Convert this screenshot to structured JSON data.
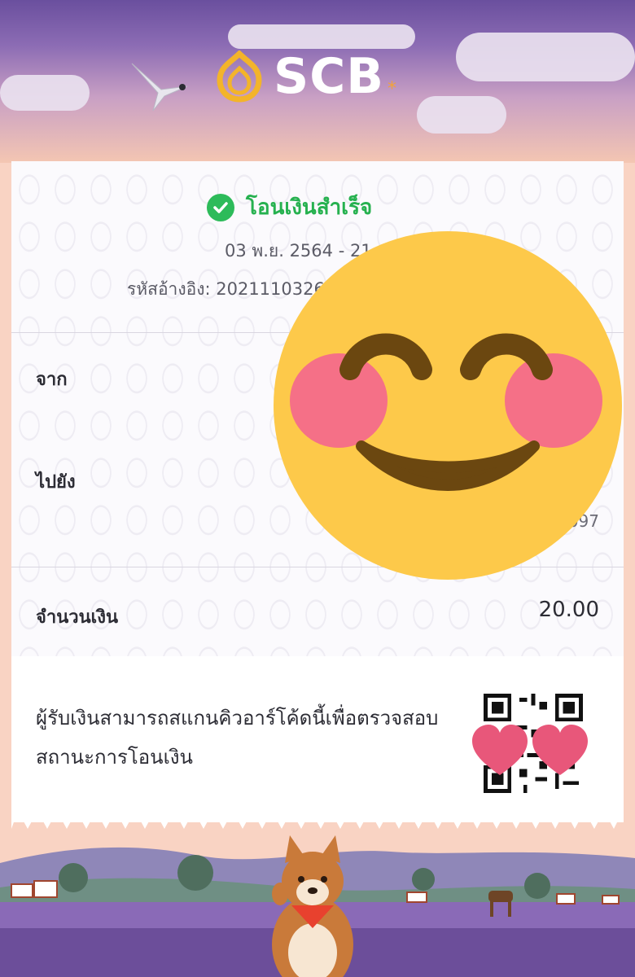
{
  "brand": {
    "name": "SCB",
    "star": "*"
  },
  "receipt": {
    "status": "โอนเงินสำเร็จ",
    "datetime": "03 พ.ย. 2564 - 21",
    "reference_label": "รหัสอ้างอิง:",
    "reference_value": "2021110326",
    "from_label": "จาก",
    "to_label": "ไปยัง",
    "to_account_suffix": "097",
    "amount_label": "จำนวนเงิน",
    "amount_value": "20.00",
    "qr_note": "ผู้รับเงินสามารถสแกนคิวอาร์โค้ดนี้เพื่อตรวจสอบสถานะการโอนเงิน"
  },
  "colors": {
    "success": "#26b14f",
    "sky_top": "#6a4f9e",
    "peach": "#f9d3c3",
    "emoji_yellow": "#fdc94a"
  },
  "icons": [
    "check-circle-icon",
    "scb-logo-icon",
    "bird-icon",
    "smiling-emoji-icon",
    "heart-icon",
    "qr-code-icon"
  ]
}
